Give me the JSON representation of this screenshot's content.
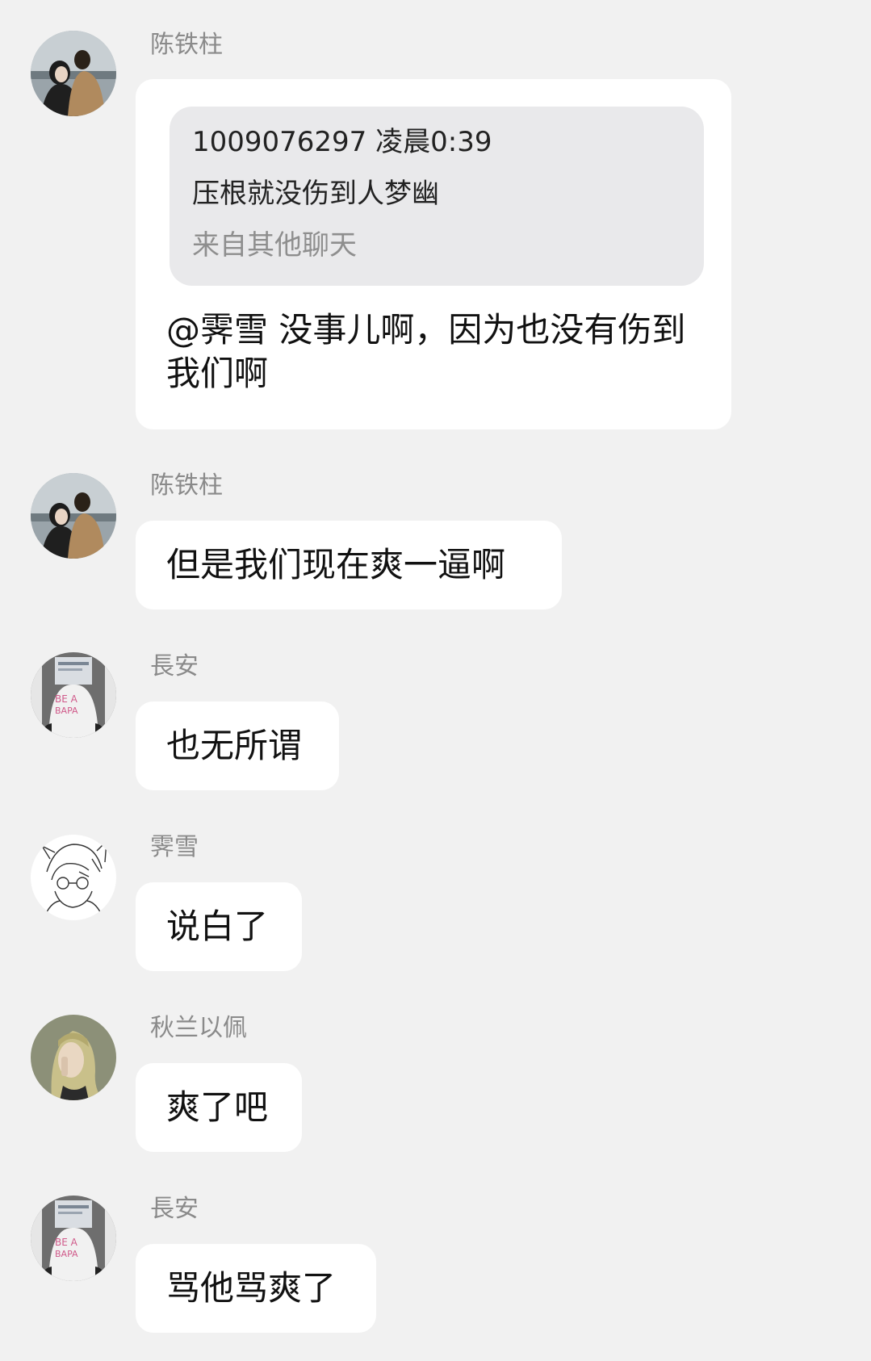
{
  "messages": [
    {
      "sender": "陈铁柱",
      "avatar": "couple-photo-avatar",
      "quote": {
        "header": "1009076297 凌晨0:39",
        "text": "压根就没伤到人梦幽",
        "source": "来自其他聊天"
      },
      "text": "@霁雪 没事儿啊，因为也没有伤到我们啊"
    },
    {
      "sender": "陈铁柱",
      "avatar": "couple-photo-avatar",
      "text": "但是我们现在爽一逼啊"
    },
    {
      "sender": "長安",
      "avatar": "newspaper-person-avatar",
      "text": "也无所谓"
    },
    {
      "sender": "霁雪",
      "avatar": "anime-sketch-avatar",
      "text": "说白了"
    },
    {
      "sender": "秋兰以佩",
      "avatar": "illustrated-girl-avatar",
      "text": "爽了吧"
    },
    {
      "sender": "長安",
      "avatar": "newspaper-person-avatar",
      "text": "骂他骂爽了"
    }
  ],
  "colors": {
    "background": "#f1f1f1",
    "bubble": "#ffffff",
    "quote_background": "#e9e9eb",
    "name_text": "#8a8a8a"
  }
}
